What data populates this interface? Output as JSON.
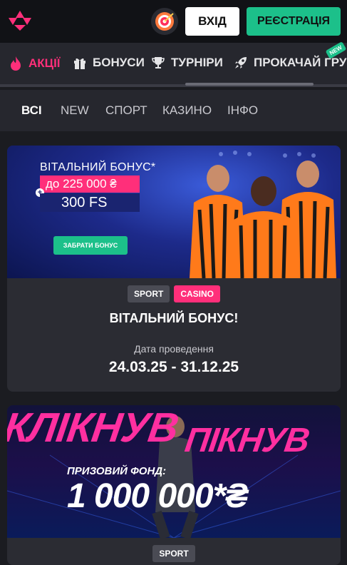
{
  "header": {
    "login_label": "ВХІД",
    "register_label": "РЕЄСТРАЦІЯ"
  },
  "nav": {
    "items": [
      {
        "label": "АКЦІЇ",
        "icon": "fire-icon",
        "active": true
      },
      {
        "label": "БОНУСИ",
        "icon": "gift-icon",
        "active": false
      },
      {
        "label": "ТУРНІРИ",
        "icon": "trophy-icon",
        "active": false
      },
      {
        "label": "ПРОКАЧАЙ ГРУ",
        "icon": "rocket-icon",
        "active": false
      }
    ],
    "new_badge": "NEW"
  },
  "subtabs": [
    "ВСІ",
    "NEW",
    "СПОРТ",
    "КАЗИНО",
    "ІНФО"
  ],
  "promos": [
    {
      "banner": {
        "title": "ВІТАЛЬНИЙ БОНУС*",
        "amount": "до 225 000 ₴",
        "fs": "300 FS",
        "button": "ЗАБРАТИ БОНУС"
      },
      "tags": [
        "SPORT",
        "CASINO"
      ],
      "title": "ВІТАЛЬНИЙ БОНУС!",
      "date_label": "Дата проведення",
      "dates": "24.03.25 - 31.12.25"
    },
    {
      "banner": {
        "headline_left": "КЛІКНУВ",
        "headline_right": "ПІКНУВ",
        "prize_label": "ПРИЗОВИЙ ФОНД:",
        "prize_amount": "1 000 000*₴"
      },
      "tags": [
        "SPORT"
      ]
    }
  ],
  "colors": {
    "accent_pink": "#ff2f7a",
    "accent_green": "#1cc08a",
    "background": "#1b1c21"
  }
}
